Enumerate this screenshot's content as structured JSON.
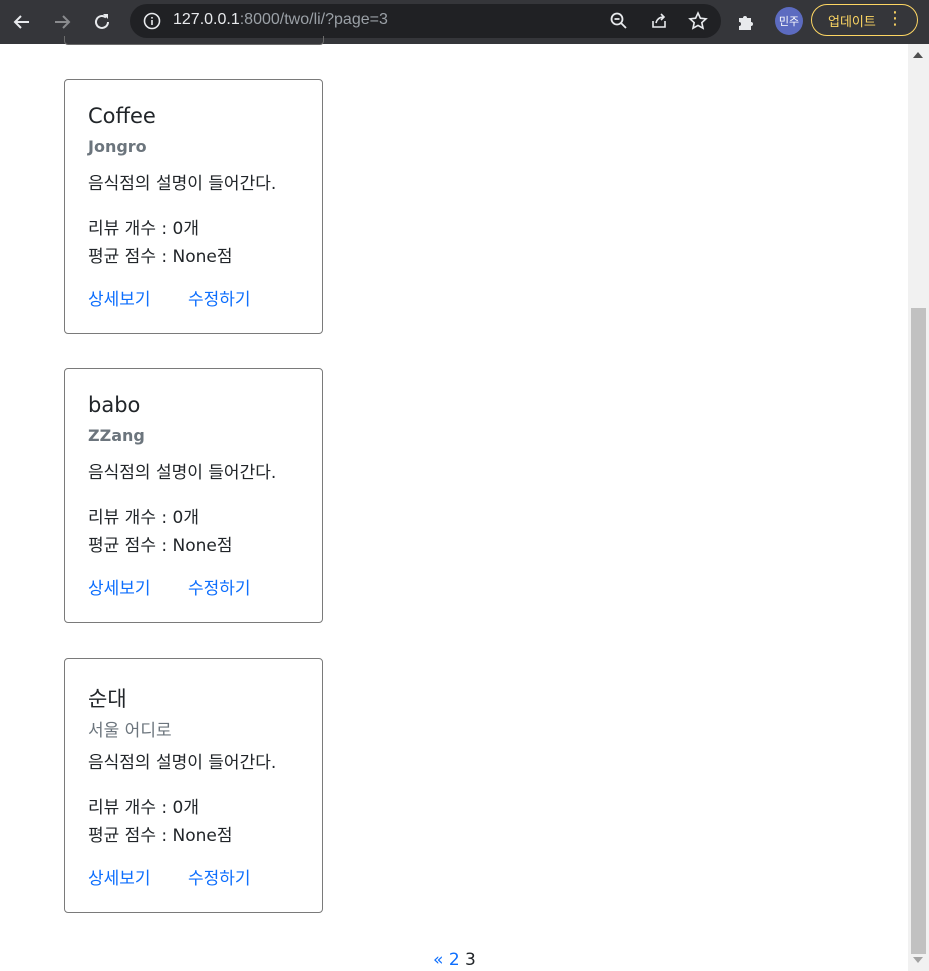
{
  "browser": {
    "url_host": "127.0.0.1",
    "url_rest": ":8000/two/li/?page=3",
    "profile_label": "민주",
    "update_label": "업데이트"
  },
  "cards": [
    {
      "title": "Coffee",
      "subtitle": "Jongro",
      "description": "음식점의 설명이 들어간다.",
      "reviews": "리뷰 개수 : 0개",
      "score": "평균 점수 : None점",
      "detail_link": "상세보기",
      "edit_link": "수정하기"
    },
    {
      "title": "babo",
      "subtitle": "ZZang",
      "description": "음식점의 설명이 들어간다.",
      "reviews": "리뷰 개수 : 0개",
      "score": "평균 점수 : None점",
      "detail_link": "상세보기",
      "edit_link": "수정하기"
    },
    {
      "title": "순대",
      "subtitle": "서울 어디로",
      "description": "음식점의 설명이 들어간다.",
      "reviews": "리뷰 개수 : 0개",
      "score": "평균 점수 : None점",
      "detail_link": "상세보기",
      "edit_link": "수정하기"
    }
  ],
  "pagination": {
    "prev_label": "«",
    "prev_page": "2",
    "current_page": "3"
  }
}
